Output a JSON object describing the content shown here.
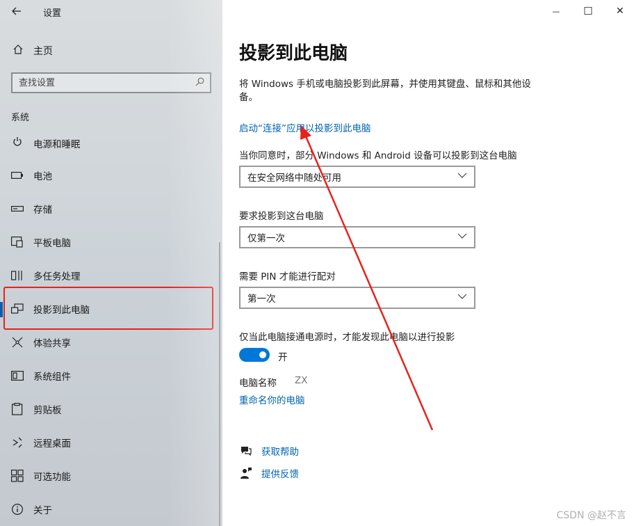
{
  "window": {
    "title": "设置",
    "minimize_glyph": "—",
    "maximize_glyph": "☐",
    "close_glyph": "✕"
  },
  "sidebar": {
    "home_label": "主页",
    "search_placeholder": "查找设置",
    "section_label": "系统",
    "items": [
      {
        "label": "电源和睡眠",
        "icon": "power-icon"
      },
      {
        "label": "电池",
        "icon": "battery-icon"
      },
      {
        "label": "存储",
        "icon": "storage-icon"
      },
      {
        "label": "平板电脑",
        "icon": "tablet-icon"
      },
      {
        "label": "多任务处理",
        "icon": "multitasking-icon"
      },
      {
        "label": "投影到此电脑",
        "icon": "project-icon"
      },
      {
        "label": "体验共享",
        "icon": "share-experience-icon"
      },
      {
        "label": "系统组件",
        "icon": "system-components-icon"
      },
      {
        "label": "剪贴板",
        "icon": "clipboard-icon"
      },
      {
        "label": "远程桌面",
        "icon": "remote-desktop-icon"
      },
      {
        "label": "可选功能",
        "icon": "optional-features-icon"
      },
      {
        "label": "关于",
        "icon": "info-icon"
      }
    ],
    "active_index": 5
  },
  "main": {
    "page_title": "投影到此电脑",
    "description": "将 Windows 手机或电脑投影到此屏幕，并使用其键盘、鼠标和其他设备。",
    "launch_link": "启动“连接”应用以投影到此电脑",
    "setting1": {
      "label": "当你同意时，部分 Windows 和 Android 设备可以投影到这台电脑",
      "value": "在安全网络中随处可用"
    },
    "setting2": {
      "label": "要求投影到这台电脑",
      "value": "仅第一次"
    },
    "setting3": {
      "label": "需要 PIN 才能进行配对",
      "value": "第一次"
    },
    "power_setting": {
      "label": "仅当此电脑接通电源时，才能发现此电脑以进行投影",
      "state": "开",
      "on": true
    },
    "pc_name_label": "电脑名称",
    "pc_name_value": "ZX",
    "rename_link": "重命名你的电脑",
    "help_link": "获取帮助",
    "feedback_link": "提供反馈"
  },
  "colors": {
    "accent": "#0063b1",
    "toggle_on": "#0078d7",
    "annotation_red": "#e8211b"
  },
  "watermark": "CSDN @赵不言"
}
